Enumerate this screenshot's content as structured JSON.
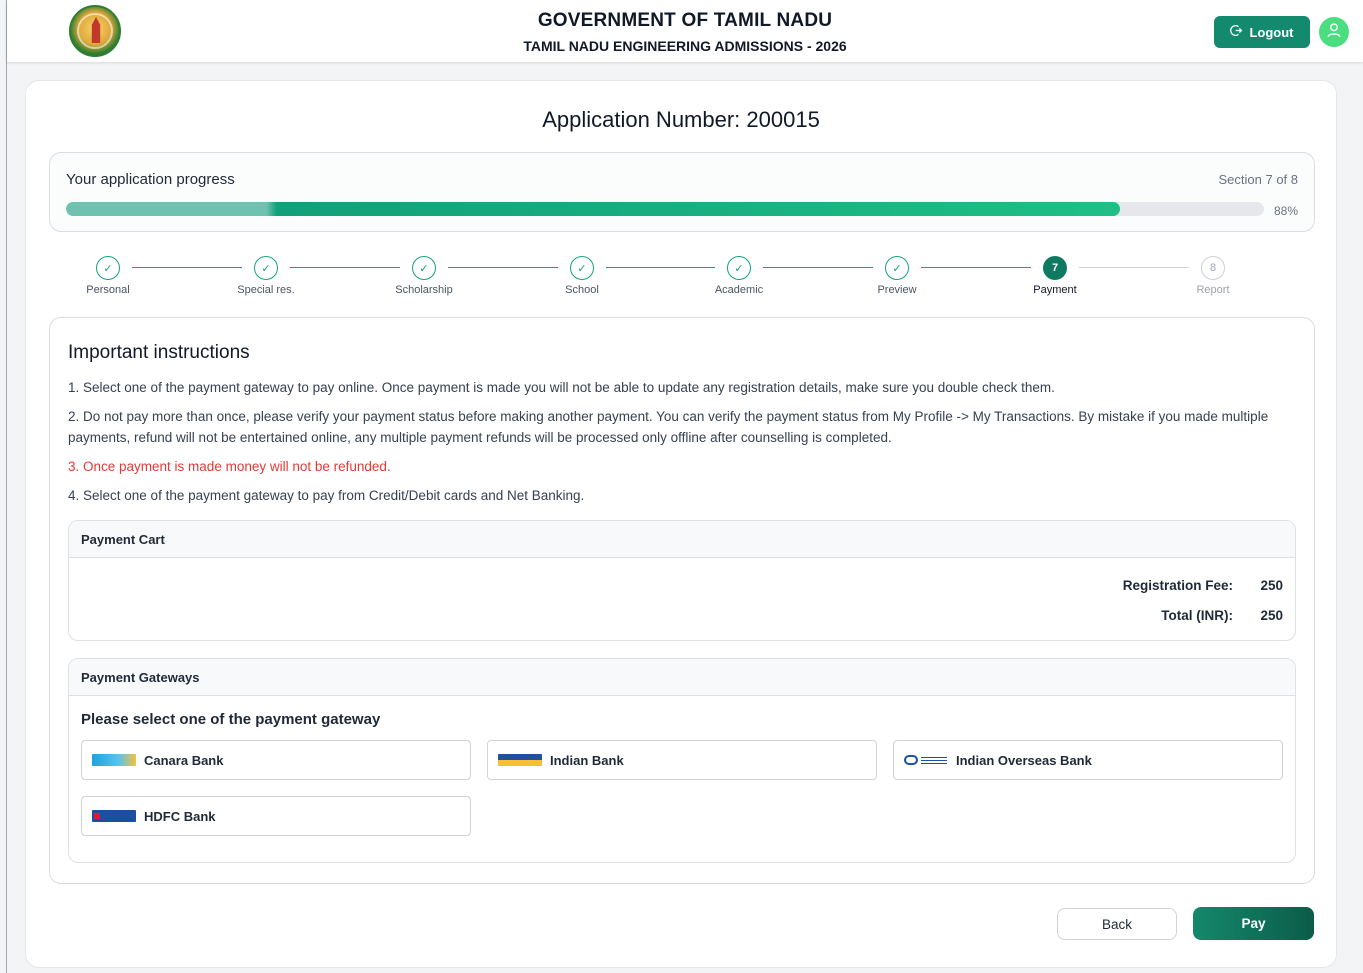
{
  "header": {
    "title": "GOVERNMENT OF TAMIL NADU",
    "subtitle": "TAMIL NADU ENGINEERING ADMISSIONS - 2026",
    "logo_icon": "tamil-nadu-emblem",
    "logout_icon": "logout-icon",
    "logout_label": "Logout",
    "avatar_icon": "user-icon"
  },
  "application": {
    "number_label": "Application Number: 200015"
  },
  "progress": {
    "label": "Your application progress",
    "section_text": "Section 7 of 8",
    "percent_text": "88%",
    "percent_value": 0.88
  },
  "steps": [
    {
      "label": "Personal",
      "state": "done",
      "marker": "✓"
    },
    {
      "label": "Special res.",
      "state": "done",
      "marker": "✓"
    },
    {
      "label": "Scholarship",
      "state": "done",
      "marker": "✓"
    },
    {
      "label": "School",
      "state": "done",
      "marker": "✓"
    },
    {
      "label": "Academic",
      "state": "done",
      "marker": "✓"
    },
    {
      "label": "Preview",
      "state": "done",
      "marker": "✓"
    },
    {
      "label": "Payment",
      "state": "active",
      "marker": "7"
    },
    {
      "label": "Report",
      "state": "pending",
      "marker": "8"
    }
  ],
  "instructions": {
    "title": "Important instructions",
    "items": [
      "1. Select one of the payment gateway to pay online. Once payment is made you will not be able to update any registration details, make sure you double check them.",
      "2. Do not pay more than once, please verify your payment status before making another payment. You can verify the payment status from My Profile -> My Transactions. By mistake if you made multiple payments, refund will not be entertained online, any multiple payment refunds will be processed only offline after counselling is completed.",
      "3. Once payment is made money will not be refunded.",
      "4. Select one of the payment gateway to pay from Credit/Debit cards and Net Banking."
    ]
  },
  "cart": {
    "title": "Payment Cart",
    "rows": [
      {
        "label": "Registration Fee:",
        "value": "250"
      },
      {
        "label": "Total (INR):",
        "value": "250"
      }
    ]
  },
  "gateways": {
    "title": "Payment Gateways",
    "prompt": "Please select one of the payment gateway",
    "banks": [
      "Canara Bank",
      "Indian Bank",
      "Indian Overseas Bank",
      "HDFC Bank"
    ]
  },
  "actions": {
    "back_label": "Back",
    "pay_label": "Pay"
  },
  "colors": {
    "primary": "#138a6e",
    "warning_text": "#e53935",
    "avatar": "#4ade80"
  }
}
